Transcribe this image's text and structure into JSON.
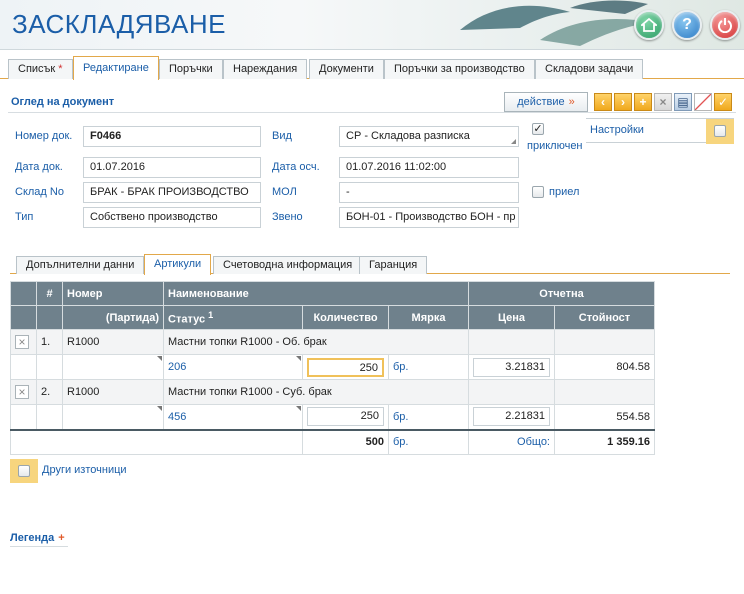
{
  "app": {
    "title": "ЗАСКЛАДЯВАНЕ"
  },
  "header_buttons": [
    "home-icon",
    "help-icon",
    "power-icon"
  ],
  "top_tabs": [
    {
      "label": "Списък",
      "required": "*"
    },
    {
      "label": "Редактиране"
    },
    {
      "label": "Поръчки"
    },
    {
      "label": "Нареждания"
    },
    {
      "label": "Документи"
    },
    {
      "label": "Поръчки за производство"
    },
    {
      "label": "Складови задачи"
    }
  ],
  "section": {
    "title": "Оглед на документ",
    "action_label": "действие",
    "action_arrow": "»"
  },
  "form": {
    "doc_no_label": "Номер док.",
    "doc_no": "F0466",
    "type_label": "Вид",
    "type_value": "СР - Складова разписка",
    "closed_label": "приключен",
    "settings_label": "Настройки",
    "doc_date_label": "Дата док.",
    "doc_date": "01.07.2016",
    "post_date_label": "Дата осч.",
    "post_date": "01.07.2016 11:02:00",
    "warehouse_label": "Склад No",
    "warehouse": "БРАК - БРАК ПРОИЗВОДСТВО",
    "mol_label": "МОЛ",
    "mol": "-",
    "accepted_label": "приел",
    "kind_label": "Тип",
    "kind": "Собствено производство",
    "unit_label": "Звено",
    "unit": "БОН-01 - Производство БОН - пр"
  },
  "sub_tabs": [
    "Допълнителни данни",
    "Артикули",
    "Счетоводна информация",
    "Гаранция"
  ],
  "table": {
    "headers": {
      "hash": "#",
      "number": "Номер",
      "name": "Наименование",
      "reporting": "Отчетна",
      "batch": "(Партида)",
      "status": "Статус",
      "status_sup": "1",
      "qty": "Количество",
      "unit": "Мярка",
      "price": "Цена",
      "value": "Стойност"
    },
    "rows": [
      {
        "index": "1.",
        "number": "R1000",
        "name": "Мастни топки R1000 - Об. брак",
        "status": "206",
        "qty": "250",
        "unit": "бр.",
        "price": "3.21831",
        "value": "804.58"
      },
      {
        "index": "2.",
        "number": "R1000",
        "name": "Мастни топки R1000 - Суб. брак",
        "status": "456",
        "qty": "250",
        "unit": "бр.",
        "price": "2.21831",
        "value": "554.58"
      }
    ],
    "total": {
      "qty": "500",
      "unit": "бр.",
      "label": "Общо:",
      "value": "1 359.16"
    }
  },
  "other_sources_label": "Други източници",
  "legend": {
    "label": "Легенда",
    "plus": "+"
  }
}
